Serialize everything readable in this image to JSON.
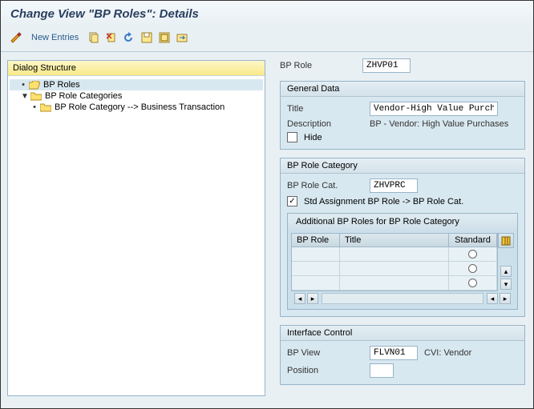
{
  "title": "Change View \"BP Roles\": Details",
  "toolbar": {
    "newEntries": "New Entries"
  },
  "tree": {
    "header": "Dialog Structure",
    "n1": "BP Roles",
    "n2": "BP Role Categories",
    "n3": "BP Role Category --> Business Transaction"
  },
  "bpRole": {
    "label": "BP Role",
    "value": "ZHVP01"
  },
  "general": {
    "title": "General Data",
    "titleLabel": "Title",
    "titleVal": "Vendor-High Value Purch.",
    "descLabel": "Description",
    "descVal": "BP - Vendor: High Value Purchases",
    "hide": "Hide"
  },
  "cat": {
    "title": "BP Role Category",
    "catLabel": "BP Role Cat.",
    "catVal": "ZHVPRC",
    "stdAssign": "Std Assignment BP Role -> BP Role Cat.",
    "addTitle": "Additional BP Roles for BP Role Category",
    "colRole": "BP Role",
    "colTitle": "Title",
    "colStd": "Standard"
  },
  "iface": {
    "title": "Interface Control",
    "viewLabel": "BP View",
    "viewVal": "FLVN01",
    "viewText": "CVI: Vendor",
    "posLabel": "Position",
    "posVal": ""
  }
}
